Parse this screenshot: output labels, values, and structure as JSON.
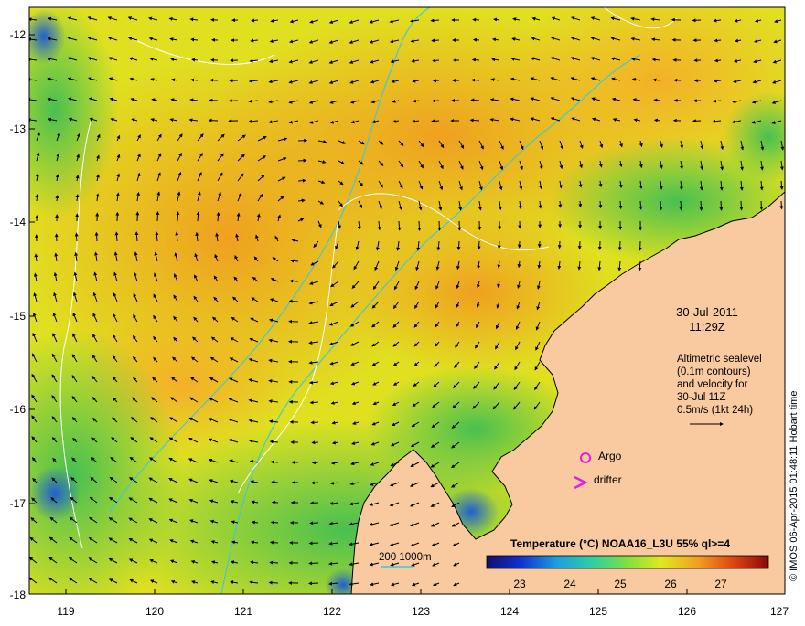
{
  "map": {
    "y_labels": [
      "-12",
      "-13",
      "-14",
      "-15",
      "-16",
      "-17",
      "-18"
    ],
    "x_labels": [
      "119",
      "120",
      "121",
      "122",
      "123",
      "124",
      "125",
      "126",
      "127"
    ],
    "date": "30-Jul-2011",
    "time": "11:29Z",
    "info_lines": [
      "Altimetric sealevel",
      "(0.1m contours)",
      "and velocity for",
      "30-Jul 11Z",
      "0.5m/s (1kt 24h)"
    ],
    "argo_label": "Argo",
    "drifter_label": "drifter",
    "depth_legend": "200  1000m",
    "legend_title": "Temperature (°C) NOAA16_L3U 55% ql>=4",
    "colorbar_ticks": [
      "23",
      "24",
      "25",
      "26",
      "27"
    ],
    "colorbar_range": [
      22.2,
      27.8
    ],
    "credit": "© IMOS 06-Apr-2015 01:48:11 Hobart time",
    "colors": {
      "land": "#f9c9a0",
      "warm_sst": "#f0a020",
      "mid_sst": "#e6e620",
      "cool_sst": "#4cc048",
      "cold_sst": "#1a40c0",
      "bathymetry": "#40c8d8",
      "argo_marker": "#e020e0"
    }
  }
}
